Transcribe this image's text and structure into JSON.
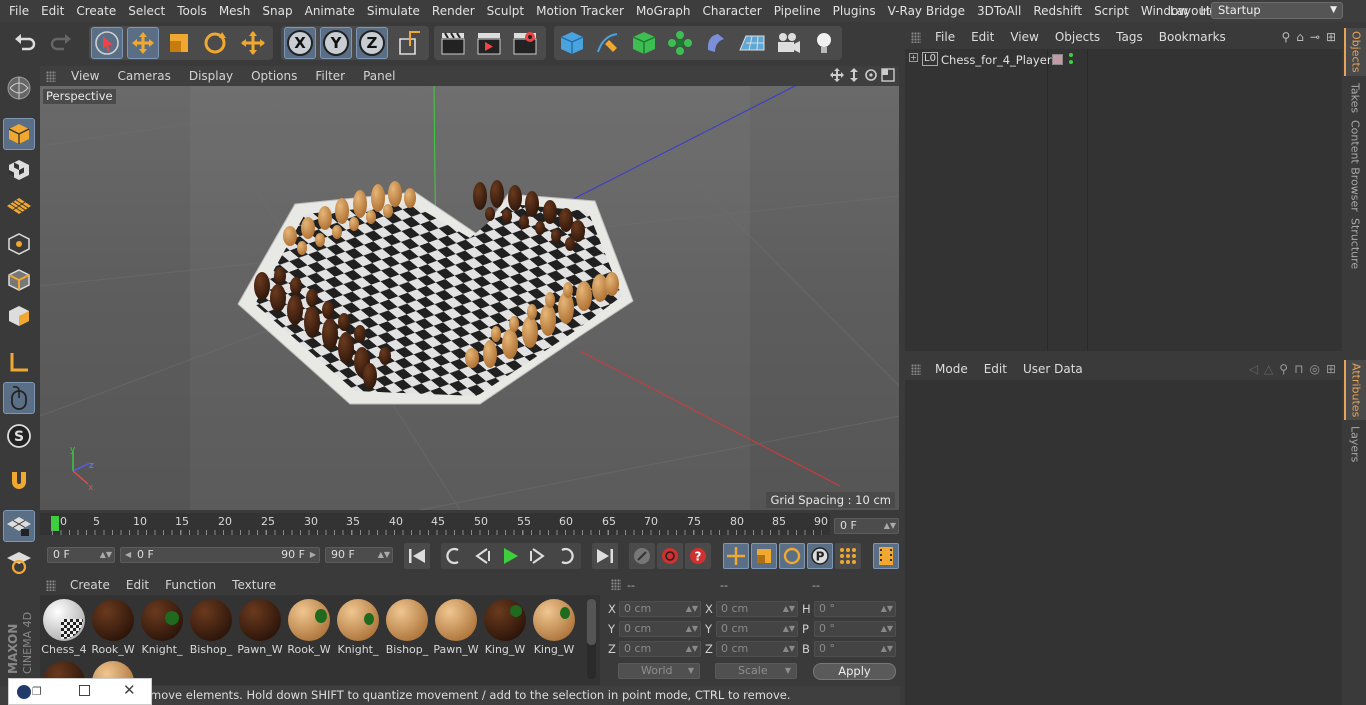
{
  "menubar": {
    "items": [
      "File",
      "Edit",
      "Create",
      "Select",
      "Tools",
      "Mesh",
      "Snap",
      "Animate",
      "Simulate",
      "Render",
      "Sculpt",
      "Motion Tracker",
      "MoGraph",
      "Character",
      "Pipeline",
      "Plugins",
      "V-Ray Bridge",
      "3DToAll",
      "Redshift",
      "Script",
      "Window",
      "Help"
    ],
    "layout_label": "Layout:",
    "layout_value": "Startup"
  },
  "toolbar": {
    "axis_x": "X",
    "axis_y": "Y",
    "axis_z": "Z"
  },
  "viewport": {
    "menu": [
      "View",
      "Cameras",
      "Display",
      "Options",
      "Filter",
      "Panel"
    ],
    "camera_label": "Perspective",
    "grid_spacing": "Grid Spacing : 10 cm",
    "axis_x": "x",
    "axis_y": "y",
    "axis_z": "z"
  },
  "timeline": {
    "ticks": [
      "0",
      "5",
      "10",
      "15",
      "20",
      "25",
      "30",
      "35",
      "40",
      "45",
      "50",
      "55",
      "60",
      "65",
      "70",
      "75",
      "80",
      "85",
      "90"
    ],
    "current_frame": "0 F",
    "start_field": "0 F",
    "range_start": "0 F",
    "range_end": "90 F",
    "end_field": "90 F"
  },
  "materials": {
    "menu": [
      "Create",
      "Edit",
      "Function",
      "Texture"
    ],
    "items": [
      {
        "name": "Chess_4",
        "color": "#e8e8e8"
      },
      {
        "name": "Rook_W",
        "color": "#3a1e10"
      },
      {
        "name": "Knight_",
        "color": "#3a1e10"
      },
      {
        "name": "Bishop_",
        "color": "#3a1e10"
      },
      {
        "name": "Pawn_W",
        "color": "#3a1e10"
      },
      {
        "name": "Rook_W",
        "color": "#c98f4f"
      },
      {
        "name": "Knight_",
        "color": "#c98f4f"
      },
      {
        "name": "Bishop_",
        "color": "#c98f4f"
      },
      {
        "name": "Pawn_W",
        "color": "#c98f4f"
      },
      {
        "name": "King_W",
        "color": "#3a1e10"
      },
      {
        "name": "King_W",
        "color": "#c98f4f"
      }
    ]
  },
  "coords": {
    "headers": [
      "--",
      "--",
      "--"
    ],
    "rows": [
      {
        "l1": "X",
        "v1": "0 cm",
        "l2": "X",
        "v2": "0 cm",
        "l3": "H",
        "v3": "0 °"
      },
      {
        "l1": "Y",
        "v1": "0 cm",
        "l2": "Y",
        "v2": "0 cm",
        "l3": "P",
        "v3": "0 °"
      },
      {
        "l1": "Z",
        "v1": "0 cm",
        "l2": "Z",
        "v2": "0 cm",
        "l3": "B",
        "v3": "0 °"
      }
    ],
    "space": "World",
    "mode": "Scale",
    "apply": "Apply"
  },
  "status_text": "move elements. Hold down SHIFT to quantize movement / add to the selection in point mode, CTRL to remove.",
  "objects": {
    "menu": [
      "File",
      "Edit",
      "View",
      "Objects",
      "Tags",
      "Bookmarks"
    ],
    "items": [
      {
        "name": "Chess_for_4_Players",
        "layer": "L0"
      }
    ]
  },
  "attributes": {
    "menu": [
      "Mode",
      "Edit",
      "User Data"
    ]
  },
  "side_tabs": [
    "Objects",
    "Takes",
    "Content Browser",
    "Structure",
    "Attributes",
    "Layers"
  ],
  "colors": {
    "accent": "#5a6f86",
    "tab_highlight": "#e8a35a"
  }
}
